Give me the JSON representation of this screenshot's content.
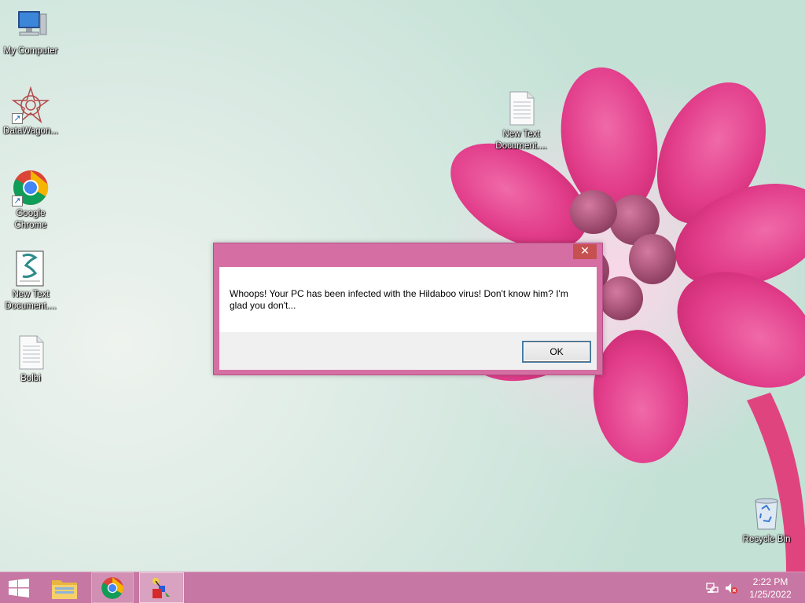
{
  "desktop": {
    "icons": [
      {
        "label": "My Computer",
        "icon": "computer-icon"
      },
      {
        "label": "DataWagon...",
        "icon": "datawagon-icon",
        "shortcut": true
      },
      {
        "label": "Google\nChrome",
        "icon": "chrome-icon",
        "shortcut": true
      },
      {
        "label": "New Text\nDocument....",
        "icon": "script-file-icon"
      },
      {
        "label": "Bolbi",
        "icon": "text-file-icon"
      },
      {
        "label": "New Text\nDocument....",
        "icon": "text-file-icon"
      },
      {
        "label": "Recycle Bin",
        "icon": "recycle-bin-icon"
      }
    ]
  },
  "dialog": {
    "close_glyph": "✕",
    "message": "Whoops! Your PC has been infected with the Hildaboo virus! Don't know him? I'm glad you don't...",
    "ok_label": "OK"
  },
  "taskbar": {
    "buttons": [
      "start-icon",
      "file-explorer-icon",
      "chrome-icon",
      "app-icon"
    ],
    "clock": {
      "time": "2:22 PM",
      "date": "1/25/2022"
    }
  },
  "colors": {
    "dialog_frame": "#d56fa3",
    "taskbar": "#c777a3",
    "close_button": "#c75050"
  }
}
